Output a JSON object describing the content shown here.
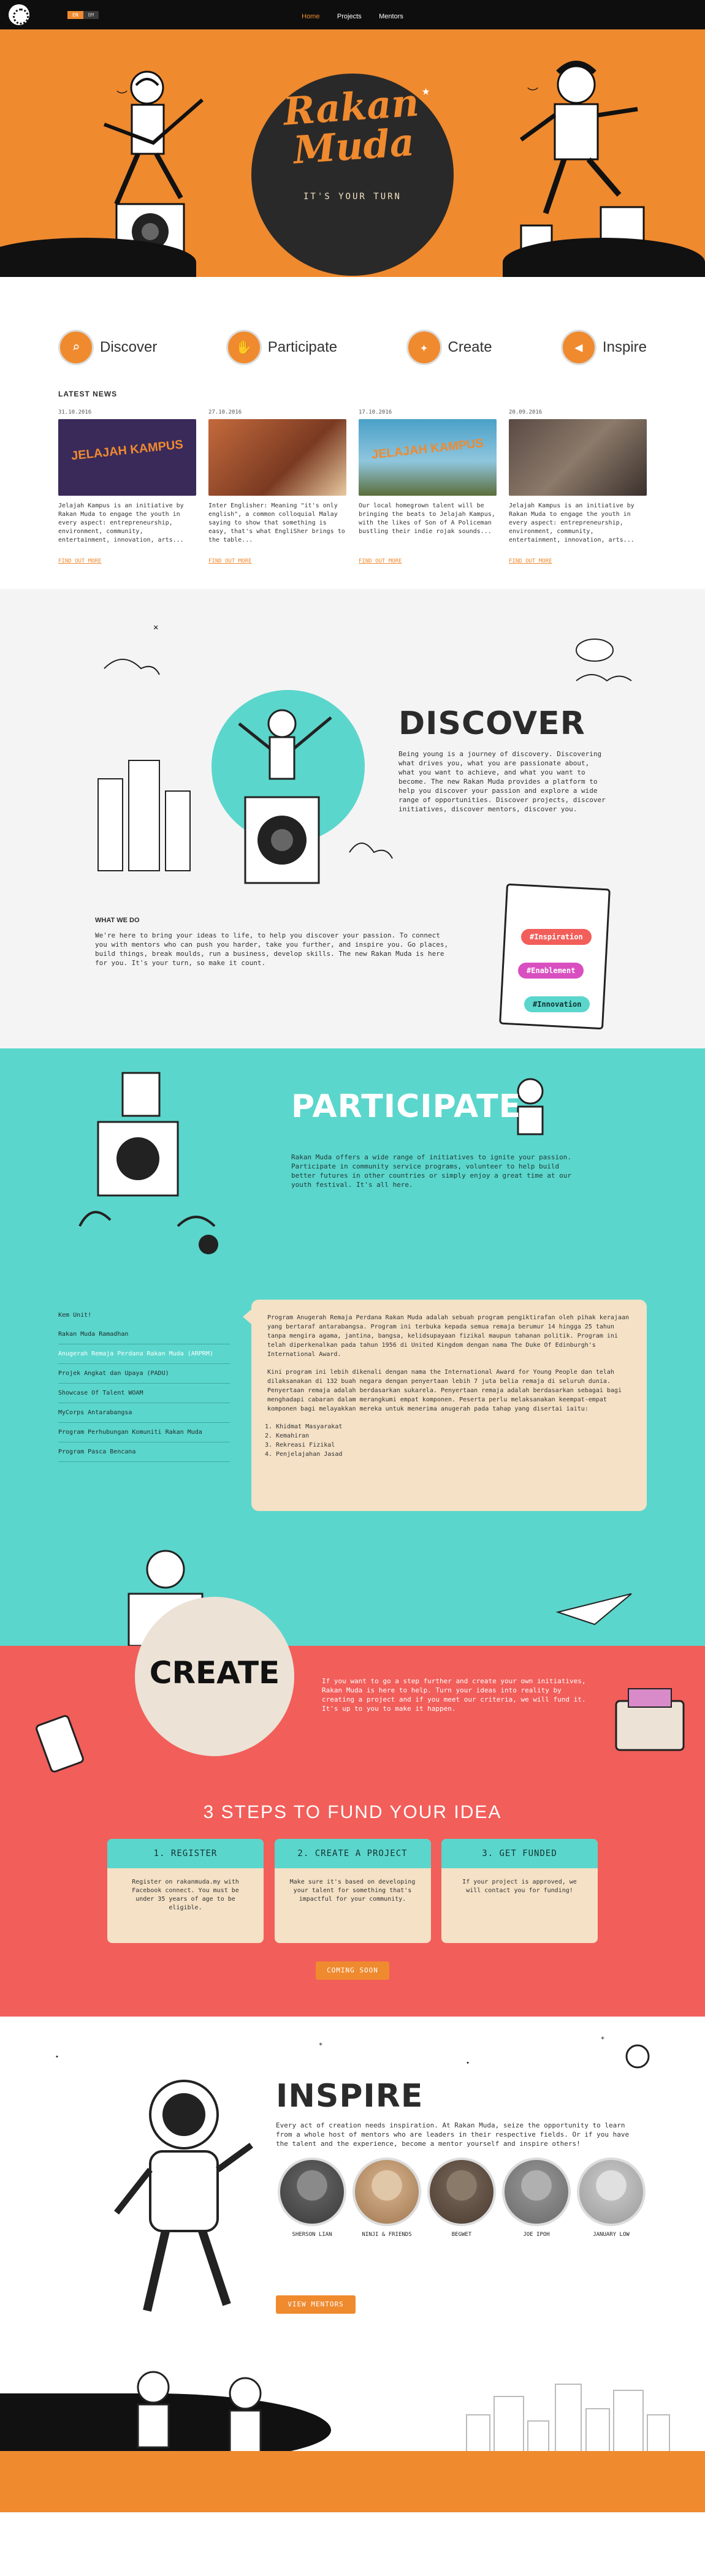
{
  "nav": {
    "languages": [
      {
        "label": "EN",
        "active": true
      },
      {
        "label": "BM",
        "active": false
      }
    ],
    "links": [
      {
        "label": "Home",
        "current": true
      },
      {
        "label": "Projects",
        "current": false
      },
      {
        "label": "Mentors",
        "current": false
      }
    ]
  },
  "hero": {
    "logo_line1": "Rakan",
    "logo_line2": "Muda",
    "tagline": "IT'S YOUR TURN"
  },
  "categories": [
    {
      "label": "Discover",
      "icon": "magnifier-icon"
    },
    {
      "label": "Participate",
      "icon": "hand-icon"
    },
    {
      "label": "Create",
      "icon": "lightbulb-icon"
    },
    {
      "label": "Inspire",
      "icon": "megaphone-icon"
    }
  ],
  "news": {
    "title": "LATEST NEWS",
    "items": [
      {
        "date": "31.10.2016",
        "text": "Jelajah Kampus is an initiative by Rakan Muda to engage the youth in every aspect: entrepreneurship, environment, community, entertainment, innovation, arts...",
        "link": "FIND OUT MORE",
        "image_text": "JELAJAH KAMPUS",
        "color": "#3a2a5a"
      },
      {
        "date": "27.10.2016",
        "text": "Inter Englisher: Meaning \"it's only english\", a common colloquial Malay saying to show that something is easy, that's what EngliSher brings to the table...",
        "link": "FIND OUT MORE",
        "image_text": "",
        "color": "#c46a3c"
      },
      {
        "date": "17.10.2016",
        "text": "Our local homegrown talent will be bringing the beats to Jelajah Kampus, with the likes of Son of A Policeman bustling their indie rojak sounds...",
        "link": "FIND OUT MORE",
        "image_text": "JELAJAH KAMPUS",
        "color": "#4aa0c8"
      },
      {
        "date": "20.09.2016",
        "text": "Jelajah Kampus is an initiative by Rakan Muda to engage the youth in every aspect: entrepreneurship, environment, community, entertainment, innovation, arts...",
        "link": "FIND OUT MORE",
        "image_text": "",
        "color": "#5a4a44"
      }
    ]
  },
  "discover": {
    "heading": "DISCOVER",
    "body": "Being young is a journey of discovery. Discovering what drives you, what you are passionate about, what you want to achieve, and what you want to become. The new Rakan Muda provides a platform to help you discover your passion and explore a wide range of opportunities. Discover projects, discover initiatives, discover mentors, discover you.",
    "what_title": "WHAT WE DO",
    "what_body": "We're here to bring your ideas to life, to help you discover your passion. To connect you with mentors who can push you harder, take you further, and inspire you. Go places, build things, break moulds, run a business, develop skills. The new Rakan Muda is here for you. It's your turn, so make it count.",
    "tags": [
      "#Inspiration",
      "#Enablement",
      "#Innovation"
    ]
  },
  "participate": {
    "heading": "PARTICIPATE",
    "body": "Rakan Muda offers a wide range of initiatives to ignite your passion. Participate in community service programs, volunteer to help build better futures in other countries or simply enjoy a great time at our youth festival. It's all here.",
    "menu": [
      {
        "label": "Kem Unit!",
        "active": false
      },
      {
        "label": "Rakan Muda Ramadhan",
        "active": false
      },
      {
        "label": "Anugerah Remaja Perdana Rakan Muda (ARPRM)",
        "active": true
      },
      {
        "label": "Projek Angkat dan Upaya (PADU)",
        "active": false
      },
      {
        "label": "Showcase Of Talent WOAM",
        "active": false
      },
      {
        "label": "MyCorps Antarabangsa",
        "active": false
      },
      {
        "label": "Program Perhubungan Komuniti Rakan Muda",
        "active": false
      },
      {
        "label": "Program Pasca Bencana",
        "active": false
      }
    ],
    "panel": {
      "para1": "Program Anugerah Remaja Perdana Rakan Muda adalah sebuah program pengiktirafan oleh pihak kerajaan yang bertaraf antarabangsa. Program ini terbuka kepada semua remaja berumur 14 hingga 25 tahun tanpa mengira agama, jantina, bangsa, kelidsupayaan fizikal maupun tahanan politik. Program ini telah diperkenalkan pada tahun 1956 di United Kingdom dengan nama The Duke Of Edinburgh's International Award.",
      "para2": "Kini program ini lebih dikenali dengan nama the International Award for Young People dan telah dilaksanakan di 132 buah negara dengan penyertaan lebih 7 juta belia remaja di seluruh dunia. Penyertaan remaja adalah berdasarkan sukarela. Penyertaan remaja adalah berdasarkan sebagai bagi menghadapi cabaran dalam merangkumi empat komponen. Peserta perlu melaksanakan keempat-empat komponen bagi melayakkan mereka untuk menerima anugerah pada tahap yang disertai iaitu:",
      "list": [
        "Khidmat Masyarakat",
        "Kemahiran",
        "Rekreasi Fizikal",
        "Penjelajahan Jasad"
      ]
    }
  },
  "create": {
    "heading": "CREATE",
    "body": "If you want to go a step further and create your own initiatives, Rakan Muda is here to help. Turn your ideas into reality by creating a project and if you meet our criteria, we will fund it. It's up to you to make it happen.",
    "steps_title": "3 STEPS TO FUND YOUR IDEA",
    "steps": [
      {
        "title": "1. REGISTER",
        "text": "Register on rakanmuda.my with Facebook connect. You must be under 35 years of age to be eligible."
      },
      {
        "title": "2. CREATE A PROJECT",
        "text": "Make sure it's based on developing your talent for something that's impactful for your community."
      },
      {
        "title": "3. GET FUNDED",
        "text": "If your project is approved, we will contact you for funding!"
      }
    ],
    "button": "COMING SOON"
  },
  "inspire": {
    "heading": "INSPIRE",
    "body": "Every act of creation needs inspiration. At Rakan Muda, seize the opportunity to learn from a whole host of mentors who are leaders in their respective fields. Or if you have the talent and the experience, become a mentor yourself and inspire others!",
    "mentors": [
      {
        "name": "SHERSON LIAN",
        "color": "#5a5a5a"
      },
      {
        "name": "NINJI & FRIENDS",
        "color": "#c7a27c"
      },
      {
        "name": "BEGWET",
        "color": "#6b5b4e"
      },
      {
        "name": "JOE IPOH",
        "color": "#8a8a8a"
      },
      {
        "name": "JANUARY LOW",
        "color": "#bdbdbd"
      }
    ],
    "button": "VIEW MENTORS"
  },
  "colors": {
    "orange": "#ef8a2f",
    "teal": "#5bd6cc",
    "coral": "#f25e5a",
    "cream": "#f4e1c6"
  }
}
